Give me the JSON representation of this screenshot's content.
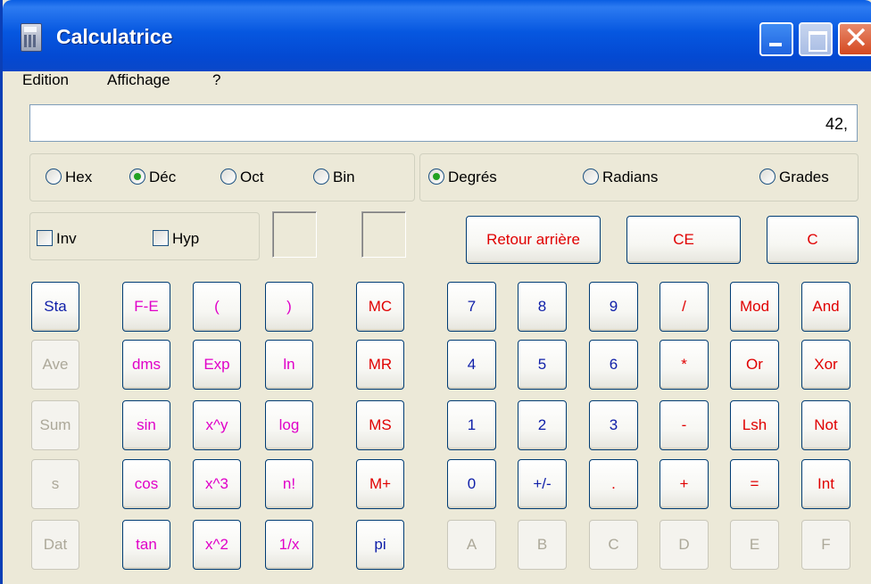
{
  "window": {
    "title": "Calculatrice"
  },
  "menu": [
    "Edition",
    "Affichage",
    "?"
  ],
  "display": {
    "value": "42,"
  },
  "base_radios": [
    {
      "label": "Hex",
      "checked": false
    },
    {
      "label": "Déc",
      "checked": true
    },
    {
      "label": "Oct",
      "checked": false
    },
    {
      "label": "Bin",
      "checked": false
    }
  ],
  "angle_radios": [
    {
      "label": "Degrés",
      "checked": true
    },
    {
      "label": "Radians",
      "checked": false
    },
    {
      "label": "Grades",
      "checked": false
    }
  ],
  "checkboxes": [
    {
      "label": "Inv",
      "checked": false
    },
    {
      "label": "Hyp",
      "checked": false
    }
  ],
  "edit_buttons": [
    "Retour arrière",
    "CE",
    "C"
  ],
  "stat_buttons": [
    "Sta",
    "Ave",
    "Sum",
    "s",
    "Dat"
  ],
  "sci_buttons": [
    [
      "F-E",
      "(",
      ")"
    ],
    [
      "dms",
      "Exp",
      "ln"
    ],
    [
      "sin",
      "x^y",
      "log"
    ],
    [
      "cos",
      "x^3",
      "n!"
    ],
    [
      "tan",
      "x^2",
      "1/x"
    ]
  ],
  "memory_buttons": [
    "MC",
    "MR",
    "MS",
    "M+",
    "pi"
  ],
  "num_buttons": [
    [
      "7",
      "8",
      "9",
      "/",
      "Mod",
      "And"
    ],
    [
      "4",
      "5",
      "6",
      "*",
      "Or",
      "Xor"
    ],
    [
      "1",
      "2",
      "3",
      "-",
      "Lsh",
      "Not"
    ],
    [
      "0",
      "+/-",
      ".",
      "+",
      "=",
      "Int"
    ],
    [
      "A",
      "B",
      "C",
      "D",
      "E",
      "F"
    ]
  ],
  "colors": {
    "digit": "#0e1ea8",
    "operator": "#e00000",
    "function": "#e000c8",
    "disabled": "#aca899",
    "titlebar": "#0657e0"
  }
}
